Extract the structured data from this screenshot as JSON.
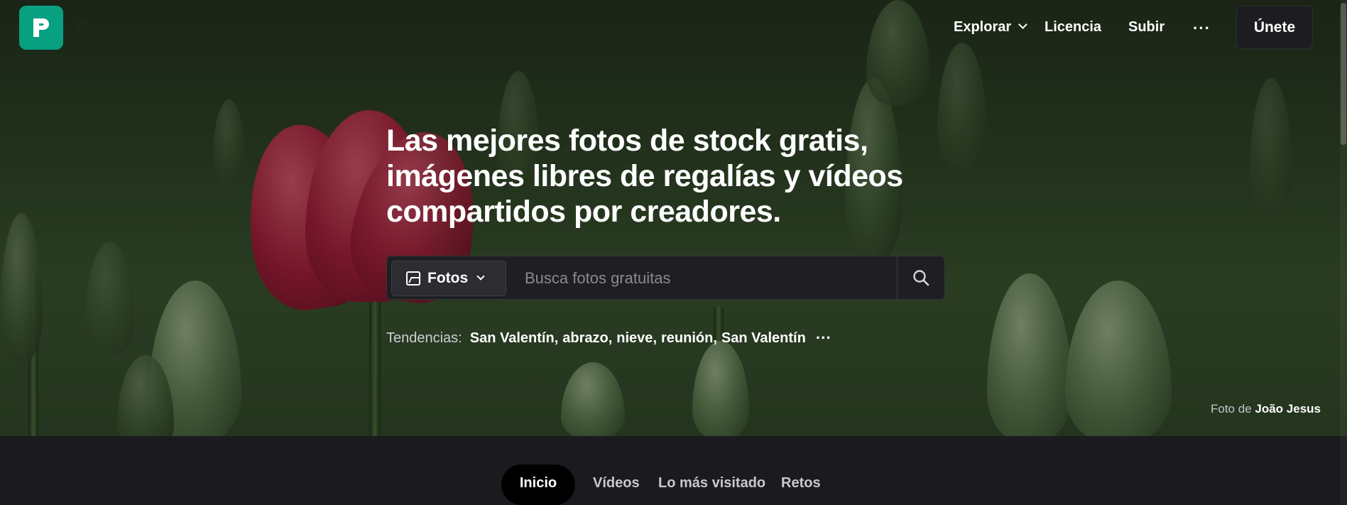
{
  "brand": {
    "name": "Pexels"
  },
  "nav": {
    "explore": "Explorar",
    "license": "Licencia",
    "upload": "Subir",
    "more": "···",
    "join": "Únete"
  },
  "hero": {
    "headline": "Las mejores fotos de stock gratis, imágenes libres de regalías y vídeos compartidos por creadores.",
    "credit_prefix": "Foto de",
    "credit_author": "João Jesus"
  },
  "search": {
    "type_label": "Fotos",
    "placeholder": "Busca fotos gratuitas"
  },
  "trends": {
    "label": "Tendencias:",
    "tags": [
      "San Valentín",
      "abrazo",
      "nieve",
      "reunión",
      "San Valentín"
    ],
    "more": "···"
  },
  "tabs": [
    {
      "label": "Inicio",
      "active": true
    },
    {
      "label": "Vídeos",
      "active": false
    },
    {
      "label": "Lo más visitado",
      "active": false
    },
    {
      "label": "Retos",
      "active": false
    }
  ],
  "colors": {
    "brand_green": "#07a081",
    "page_dark": "#1b1b1f",
    "tulip_red": "#a3203a"
  },
  "icons": [
    "pexels-logo-icon",
    "chevron-down-icon",
    "more-dots-icon",
    "image-icon",
    "search-icon"
  ]
}
